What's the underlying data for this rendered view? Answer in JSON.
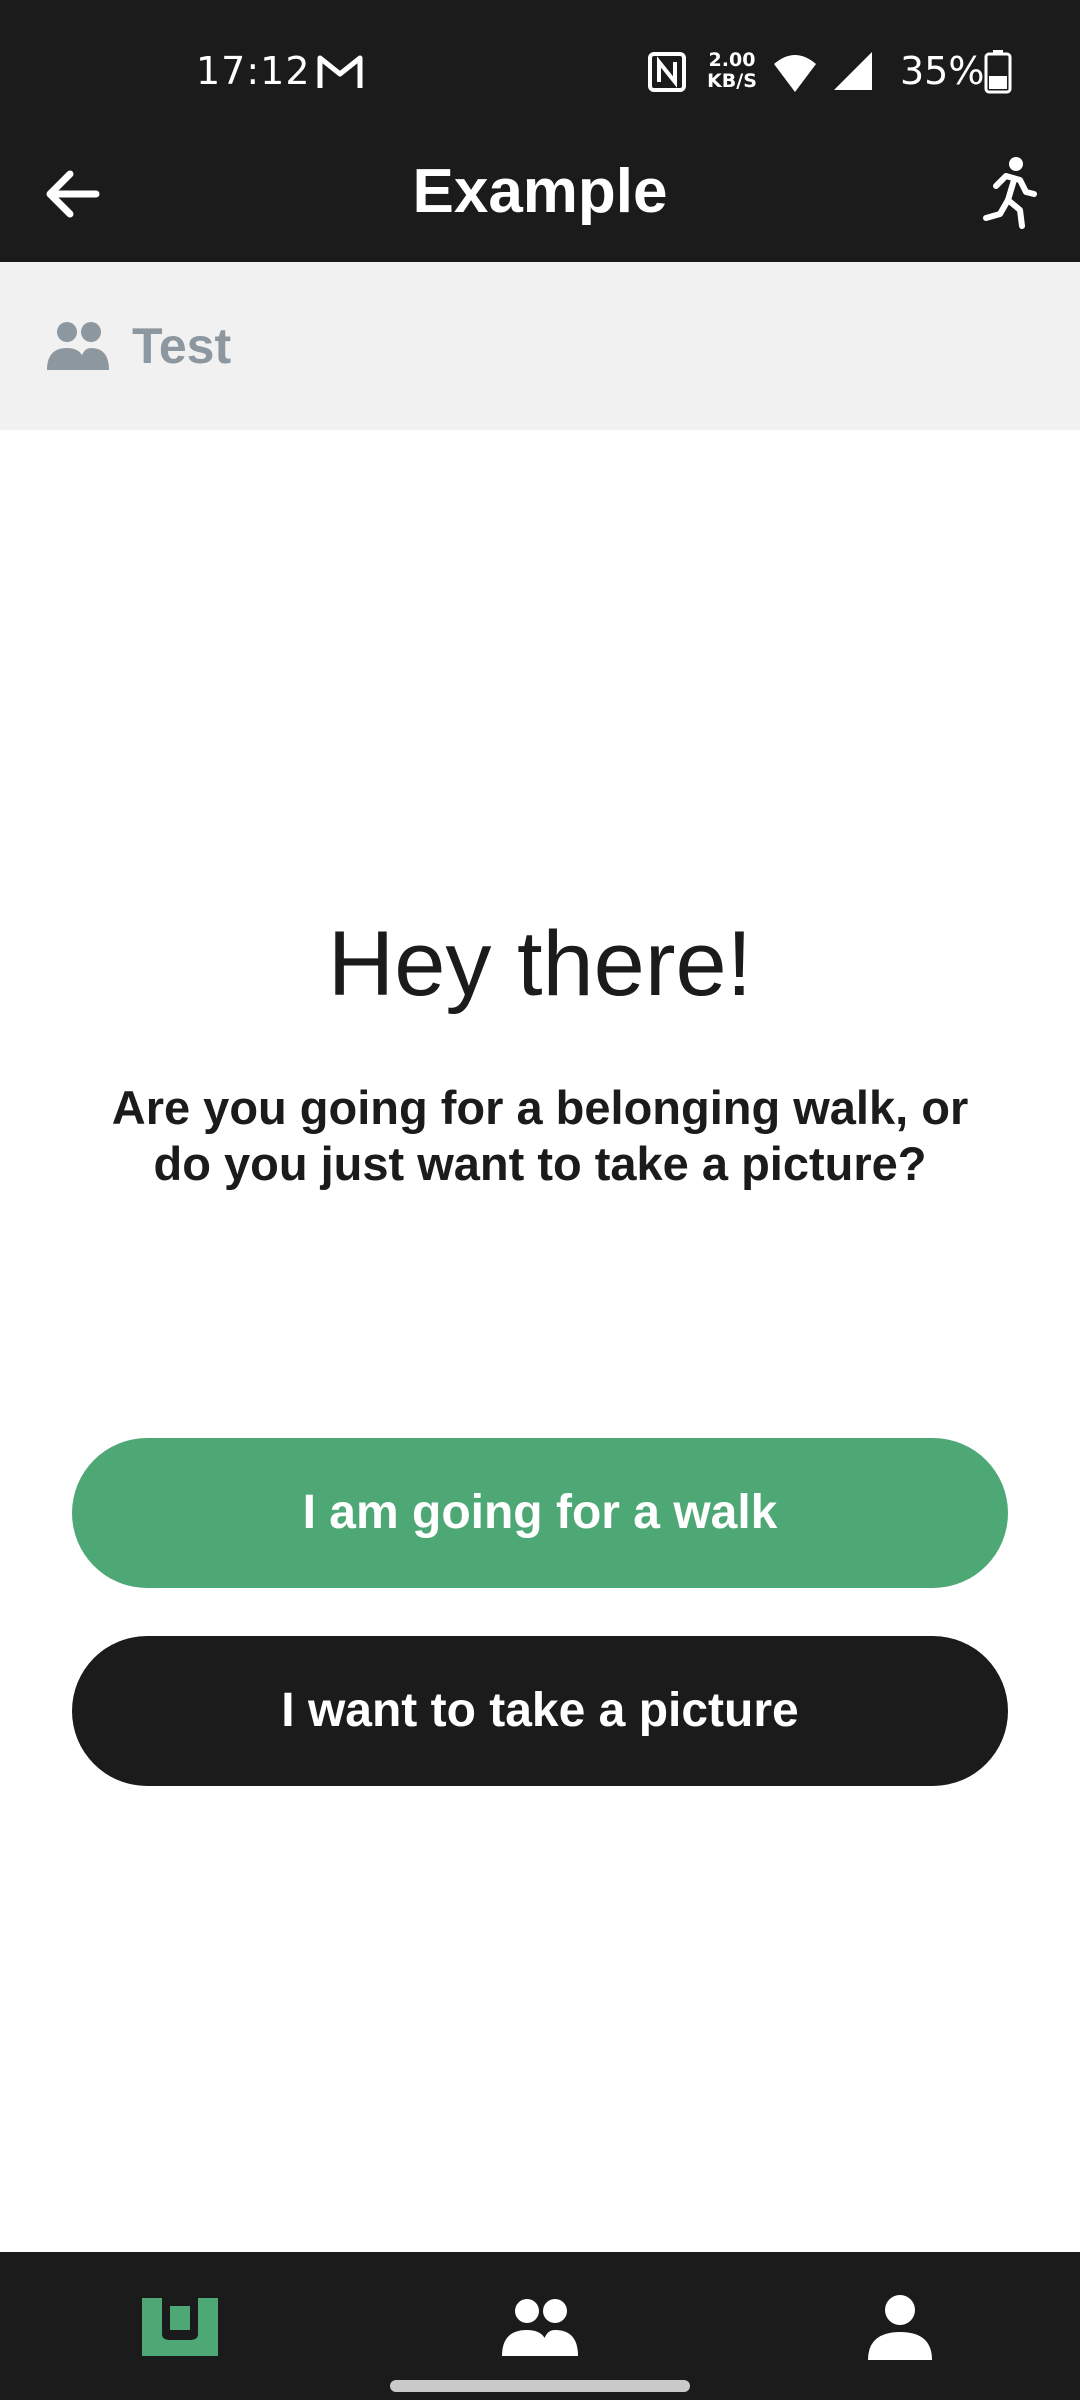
{
  "status_bar": {
    "time": "17:12",
    "network_speed_value": "2.00",
    "network_speed_unit": "KB/S",
    "battery_percent": "35%",
    "icons": [
      "gmail-icon",
      "nfc-icon",
      "wifi-icon",
      "signal-icon",
      "battery-icon"
    ]
  },
  "app_bar": {
    "title": "Example",
    "back_icon": "arrow-left-icon",
    "action_icon": "walking-person-icon"
  },
  "group": {
    "icon": "people-icon",
    "name": "Test"
  },
  "main": {
    "greeting": "Hey there!",
    "question": "Are you going for a belonging walk, or do you just want to take a picture?",
    "walk_button": "I am going for a walk",
    "picture_button": "I want to take a picture"
  },
  "bottom_nav": {
    "items": [
      {
        "icon": "app-logo-icon",
        "active": true
      },
      {
        "icon": "people-icon",
        "active": false
      },
      {
        "icon": "person-icon",
        "active": false
      }
    ]
  },
  "colors": {
    "dark": "#1b1b1c",
    "accent_green": "#4ea876",
    "group_bar_bg": "#f1f1f1",
    "muted_gray": "#8d979f"
  }
}
